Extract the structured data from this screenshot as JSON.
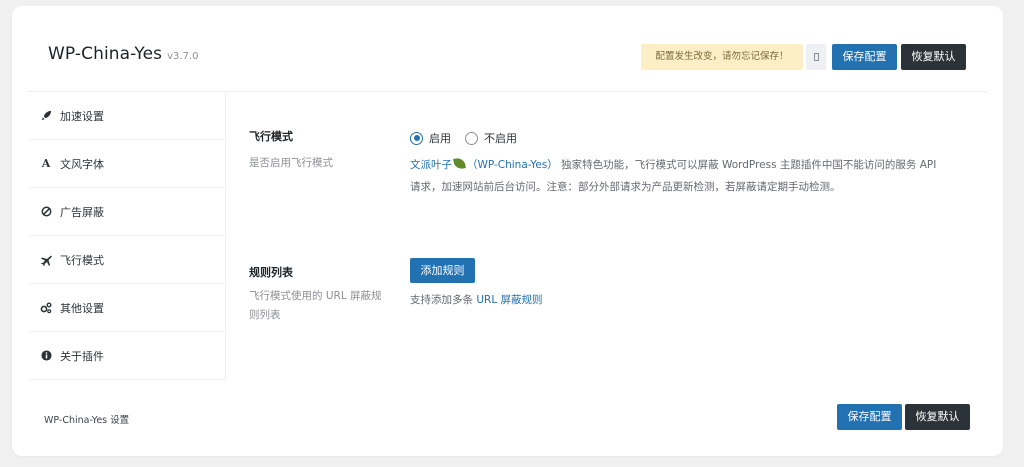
{
  "header": {
    "title": "WP-China-Yes",
    "version": "v3.7.0",
    "notice": "配置发生改变，请勿忘记保存！",
    "save_label": "保存配置",
    "reset_label": "恢复默认"
  },
  "sidebar": {
    "items": [
      {
        "label": "加速设置",
        "icon": "rocket-icon"
      },
      {
        "label": "文风字体",
        "icon": "font-icon"
      },
      {
        "label": "广告屏蔽",
        "icon": "ban-icon"
      },
      {
        "label": "飞行模式",
        "icon": "plane-icon"
      },
      {
        "label": "其他设置",
        "icon": "cogs-icon"
      },
      {
        "label": "关于插件",
        "icon": "info-icon"
      }
    ],
    "active_index": 3
  },
  "fly_mode": {
    "title": "飞行模式",
    "desc": "是否启用飞行模式",
    "option_on": "启用",
    "option_off": "不启用",
    "selected": "启用",
    "link_author": "文派叶子",
    "link_project": "（WP-China-Yes）",
    "desc_line1": "独家特色功能，飞行模式可以屏蔽 WordPress 主题插件中国不能访问的服务 API",
    "desc_line2": "请求，加速网站前后台访问。注意：部分外部请求为产品更新检测，若屏蔽请定期手动检测。"
  },
  "rules": {
    "title": "规则列表",
    "desc_line1": "飞行模式使用的 URL 屏蔽规",
    "desc_line2": "则列表",
    "add_label": "添加规则",
    "help_prefix": "支持添加多条",
    "help_link": "URL 屏蔽规则"
  },
  "footer": {
    "text": "WP-China-Yes 设置",
    "save_label": "保存配置",
    "reset_label": "恢复默认"
  },
  "colors": {
    "primary": "#2271b1",
    "dark": "#2c3338",
    "notice_bg": "#fcefc8",
    "leaf": "#5c8a2e"
  }
}
